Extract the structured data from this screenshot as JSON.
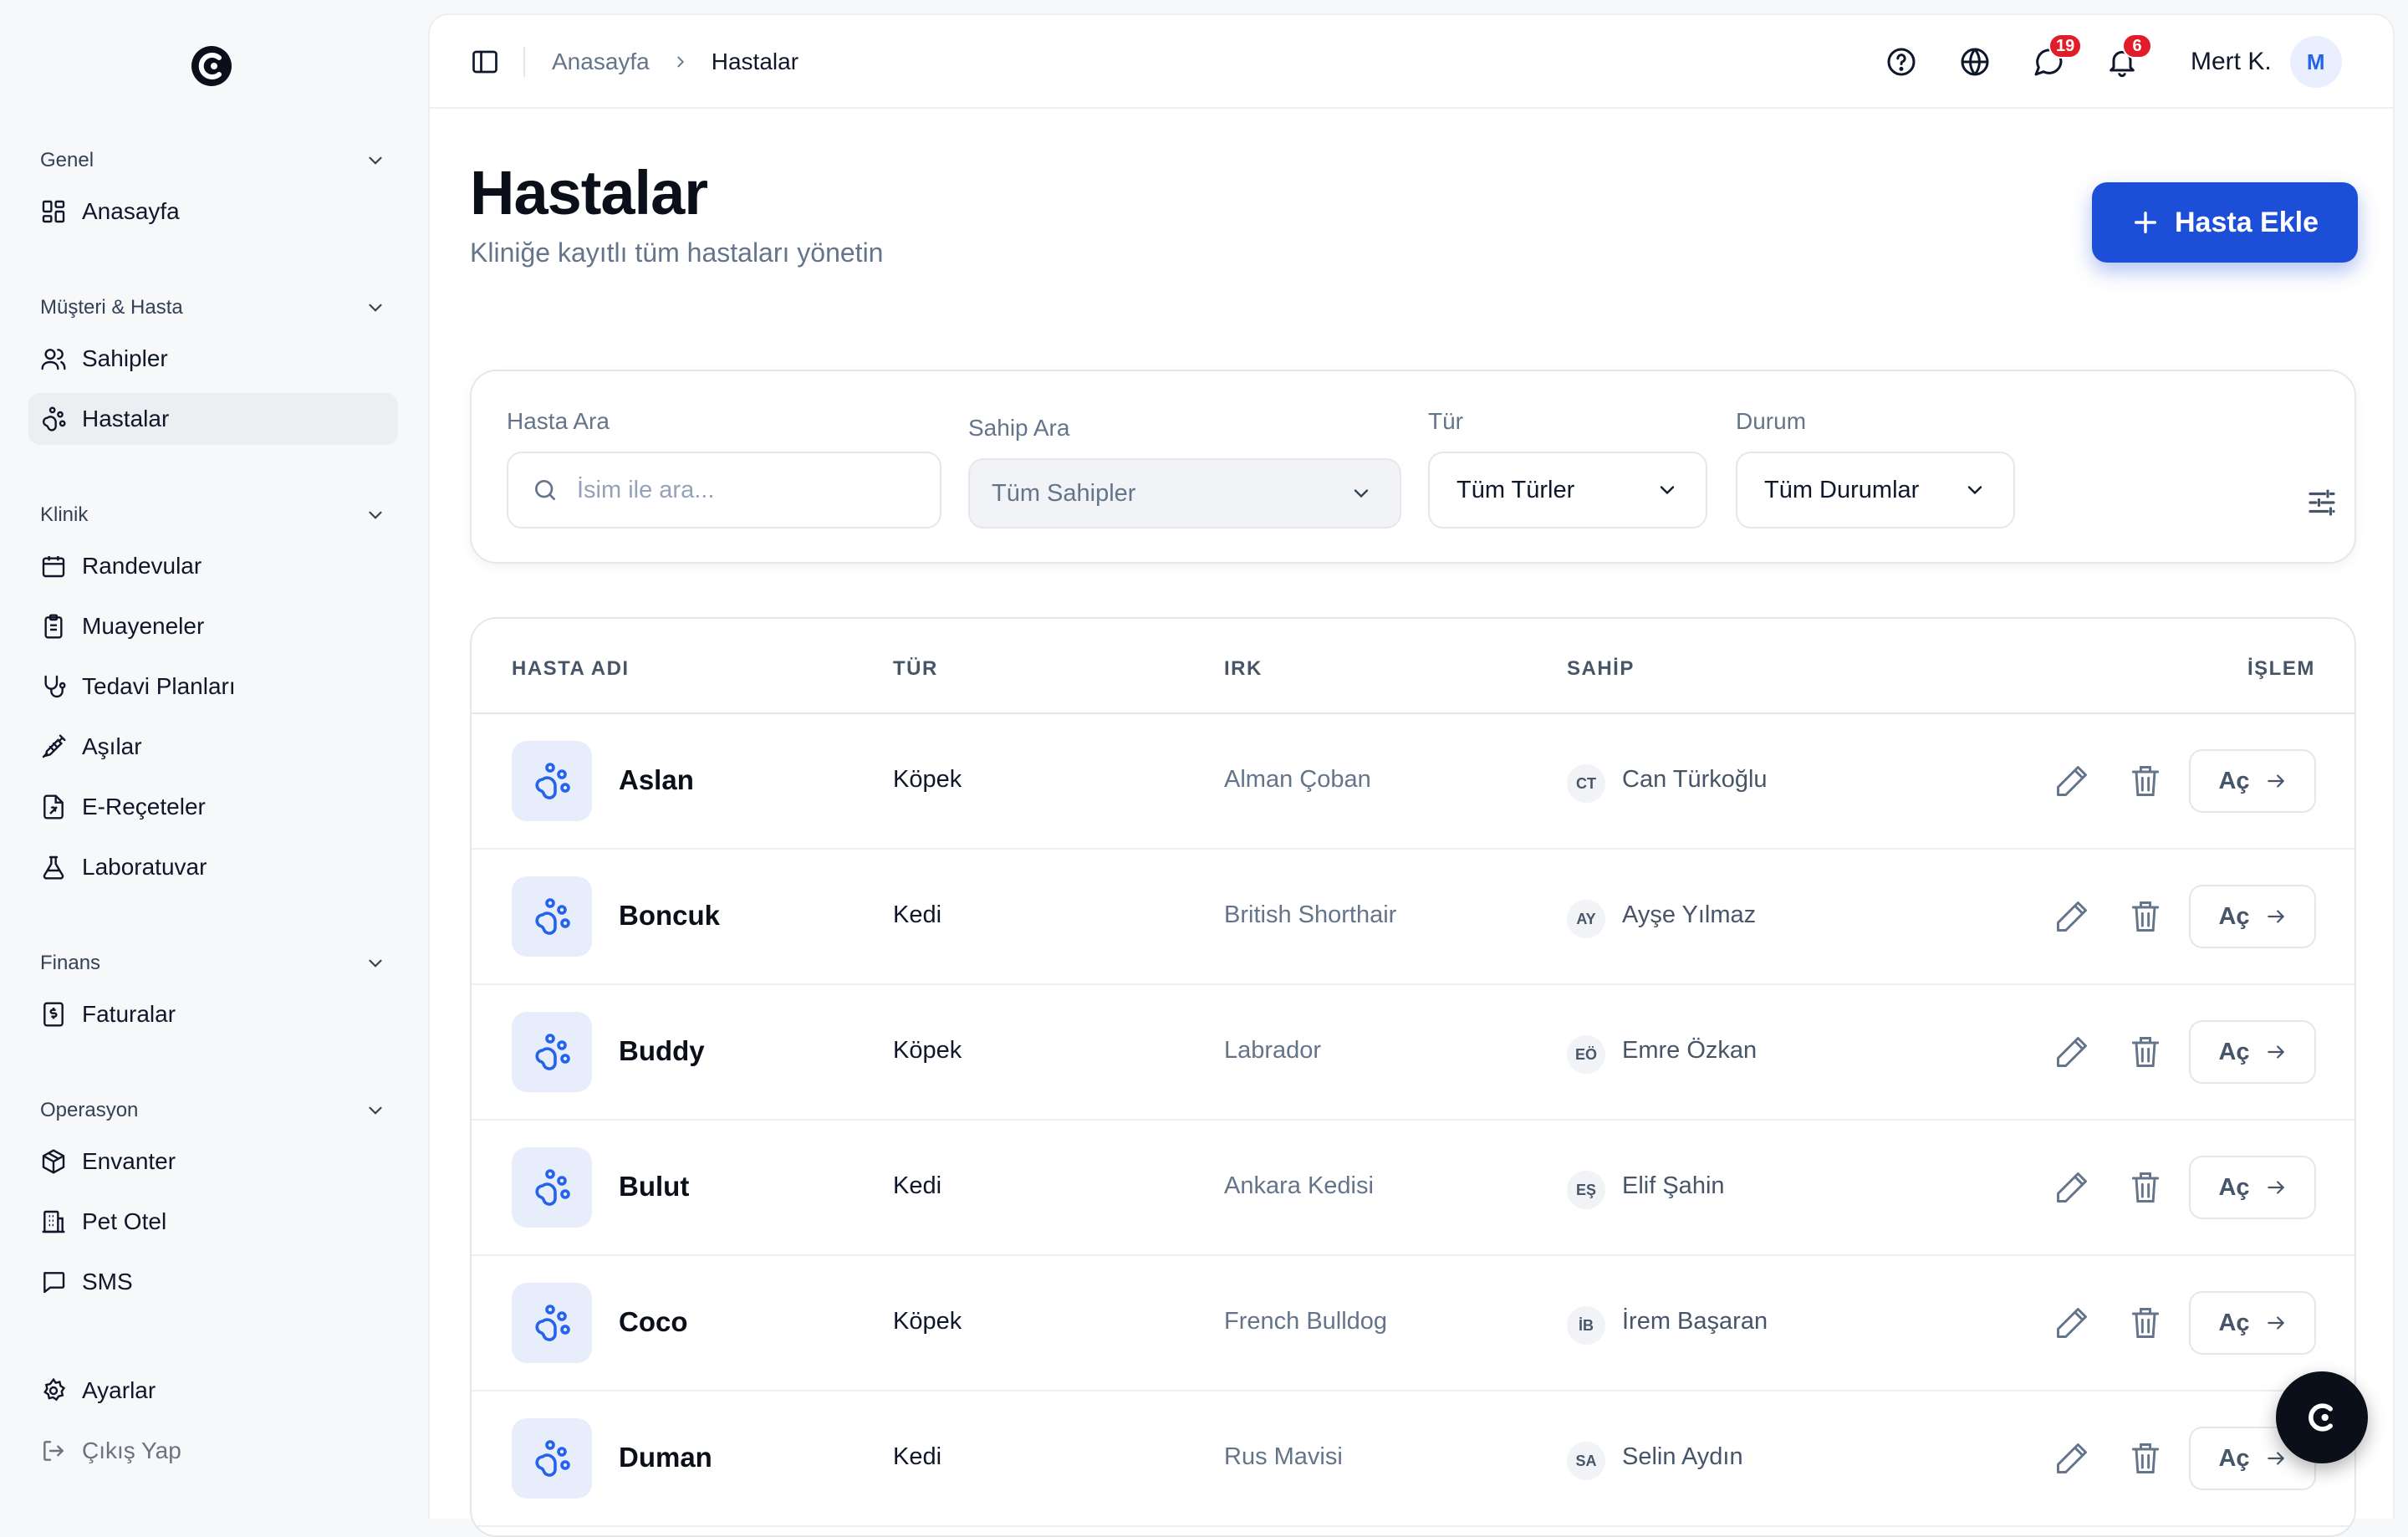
{
  "sidebar": {
    "groups": [
      {
        "label": "Genel",
        "items": [
          {
            "label": "Anasayfa",
            "icon": "dashboard-icon"
          }
        ]
      },
      {
        "label": "Müşteri & Hasta",
        "items": [
          {
            "label": "Sahipler",
            "icon": "users-icon"
          },
          {
            "label": "Hastalar",
            "icon": "paw-icon"
          }
        ]
      },
      {
        "label": "Klinik",
        "items": [
          {
            "label": "Randevular",
            "icon": "calendar-icon"
          },
          {
            "label": "Muayeneler",
            "icon": "clipboard-icon"
          },
          {
            "label": "Tedavi Planları",
            "icon": "stethoscope-icon"
          },
          {
            "label": "Aşılar",
            "icon": "syringe-icon"
          },
          {
            "label": "E-Reçeteler",
            "icon": "prescription-icon"
          },
          {
            "label": "Laboratuvar",
            "icon": "flask-icon"
          }
        ]
      },
      {
        "label": "Finans",
        "items": [
          {
            "label": "Faturalar",
            "icon": "invoice-icon"
          }
        ]
      },
      {
        "label": "Operasyon",
        "items": [
          {
            "label": "Envanter",
            "icon": "package-icon"
          },
          {
            "label": "Pet Otel",
            "icon": "building-icon"
          },
          {
            "label": "SMS",
            "icon": "message-icon"
          }
        ]
      }
    ],
    "settings_label": "Ayarlar",
    "logout_label": "Çıkış Yap"
  },
  "topbar": {
    "breadcrumb_home": "Anasayfa",
    "breadcrumb_current": "Hastalar",
    "messages_badge": "19",
    "notifications_badge": "6",
    "user_name": "Mert K.",
    "user_initial": "M"
  },
  "page": {
    "title": "Hastalar",
    "subtitle": "Kliniğe kayıtlı tüm hastaları yönetin",
    "add_button": "Hasta Ekle"
  },
  "filters": {
    "patient_search_label": "Hasta Ara",
    "patient_search_placeholder": "İsim ile ara...",
    "owner_search_label": "Sahip Ara",
    "owner_search_value": "Tüm Sahipler",
    "type_label": "Tür",
    "type_value": "Tüm Türler",
    "status_label": "Durum",
    "status_value": "Tüm Durumlar"
  },
  "table": {
    "headers": {
      "name": "HASTA ADI",
      "type": "TÜR",
      "breed": "IRK",
      "owner": "SAHİP",
      "action": "İŞLEM"
    },
    "open_label": "Aç",
    "rows": [
      {
        "name": "Aslan",
        "type": "Köpek",
        "breed": "Alman Çoban",
        "owner_initials": "CT",
        "owner": "Can Türkoğlu"
      },
      {
        "name": "Boncuk",
        "type": "Kedi",
        "breed": "British Shorthair",
        "owner_initials": "AY",
        "owner": "Ayşe Yılmaz"
      },
      {
        "name": "Buddy",
        "type": "Köpek",
        "breed": "Labrador",
        "owner_initials": "EÖ",
        "owner": "Emre Özkan"
      },
      {
        "name": "Bulut",
        "type": "Kedi",
        "breed": "Ankara Kedisi",
        "owner_initials": "EŞ",
        "owner": "Elif Şahin"
      },
      {
        "name": "Coco",
        "type": "Köpek",
        "breed": "French Bulldog",
        "owner_initials": "İB",
        "owner": "İrem Başaran"
      },
      {
        "name": "Duman",
        "type": "Kedi",
        "breed": "Rus Mavisi",
        "owner_initials": "SA",
        "owner": "Selin Aydın"
      }
    ]
  },
  "colors": {
    "accent": "#1d4ed8",
    "badge": "#e11d2a",
    "active_nav": "#eceef2"
  }
}
